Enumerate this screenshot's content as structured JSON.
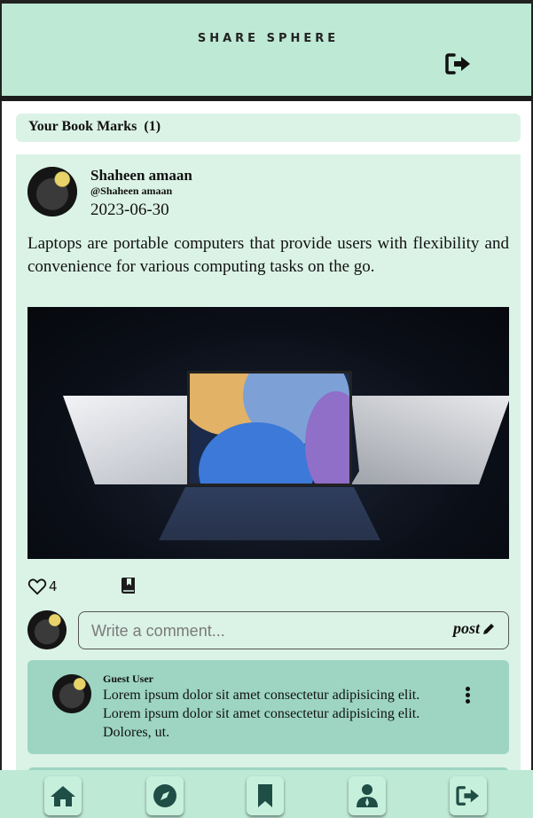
{
  "header": {
    "brand": "SHARE SPHERE",
    "logout_icon": "logout-icon"
  },
  "bookmarks": {
    "label": "Your Book Marks",
    "count": "(1)"
  },
  "post": {
    "author": "Shaheen amaan",
    "handle": "@Shaheen amaan",
    "date": "2023-06-30",
    "text": "Laptops are portable computers that provide users with flexibility and convenience for various computing tasks on the go.",
    "likes": "4",
    "icons": [
      "heart-icon",
      "bookmark-icon"
    ]
  },
  "comment_form": {
    "placeholder": "Write a comment...",
    "post_label": "post"
  },
  "comments": [
    {
      "author": "Guest User",
      "text": "Lorem ipsum dolor sit amet consectetur adipisicing elit. Lorem ipsum dolor sit amet consectetur adipisicing elit. Dolores, ut."
    }
  ],
  "bottom_nav": [
    "home-icon",
    "compass-icon",
    "bookmark-icon",
    "user-icon",
    "logout-icon"
  ],
  "colors": {
    "header_bg": "#bde9d5",
    "card_bg": "#dbf3e7",
    "comment_bg": "#9dd5c2",
    "icon": "#1f4e46"
  }
}
